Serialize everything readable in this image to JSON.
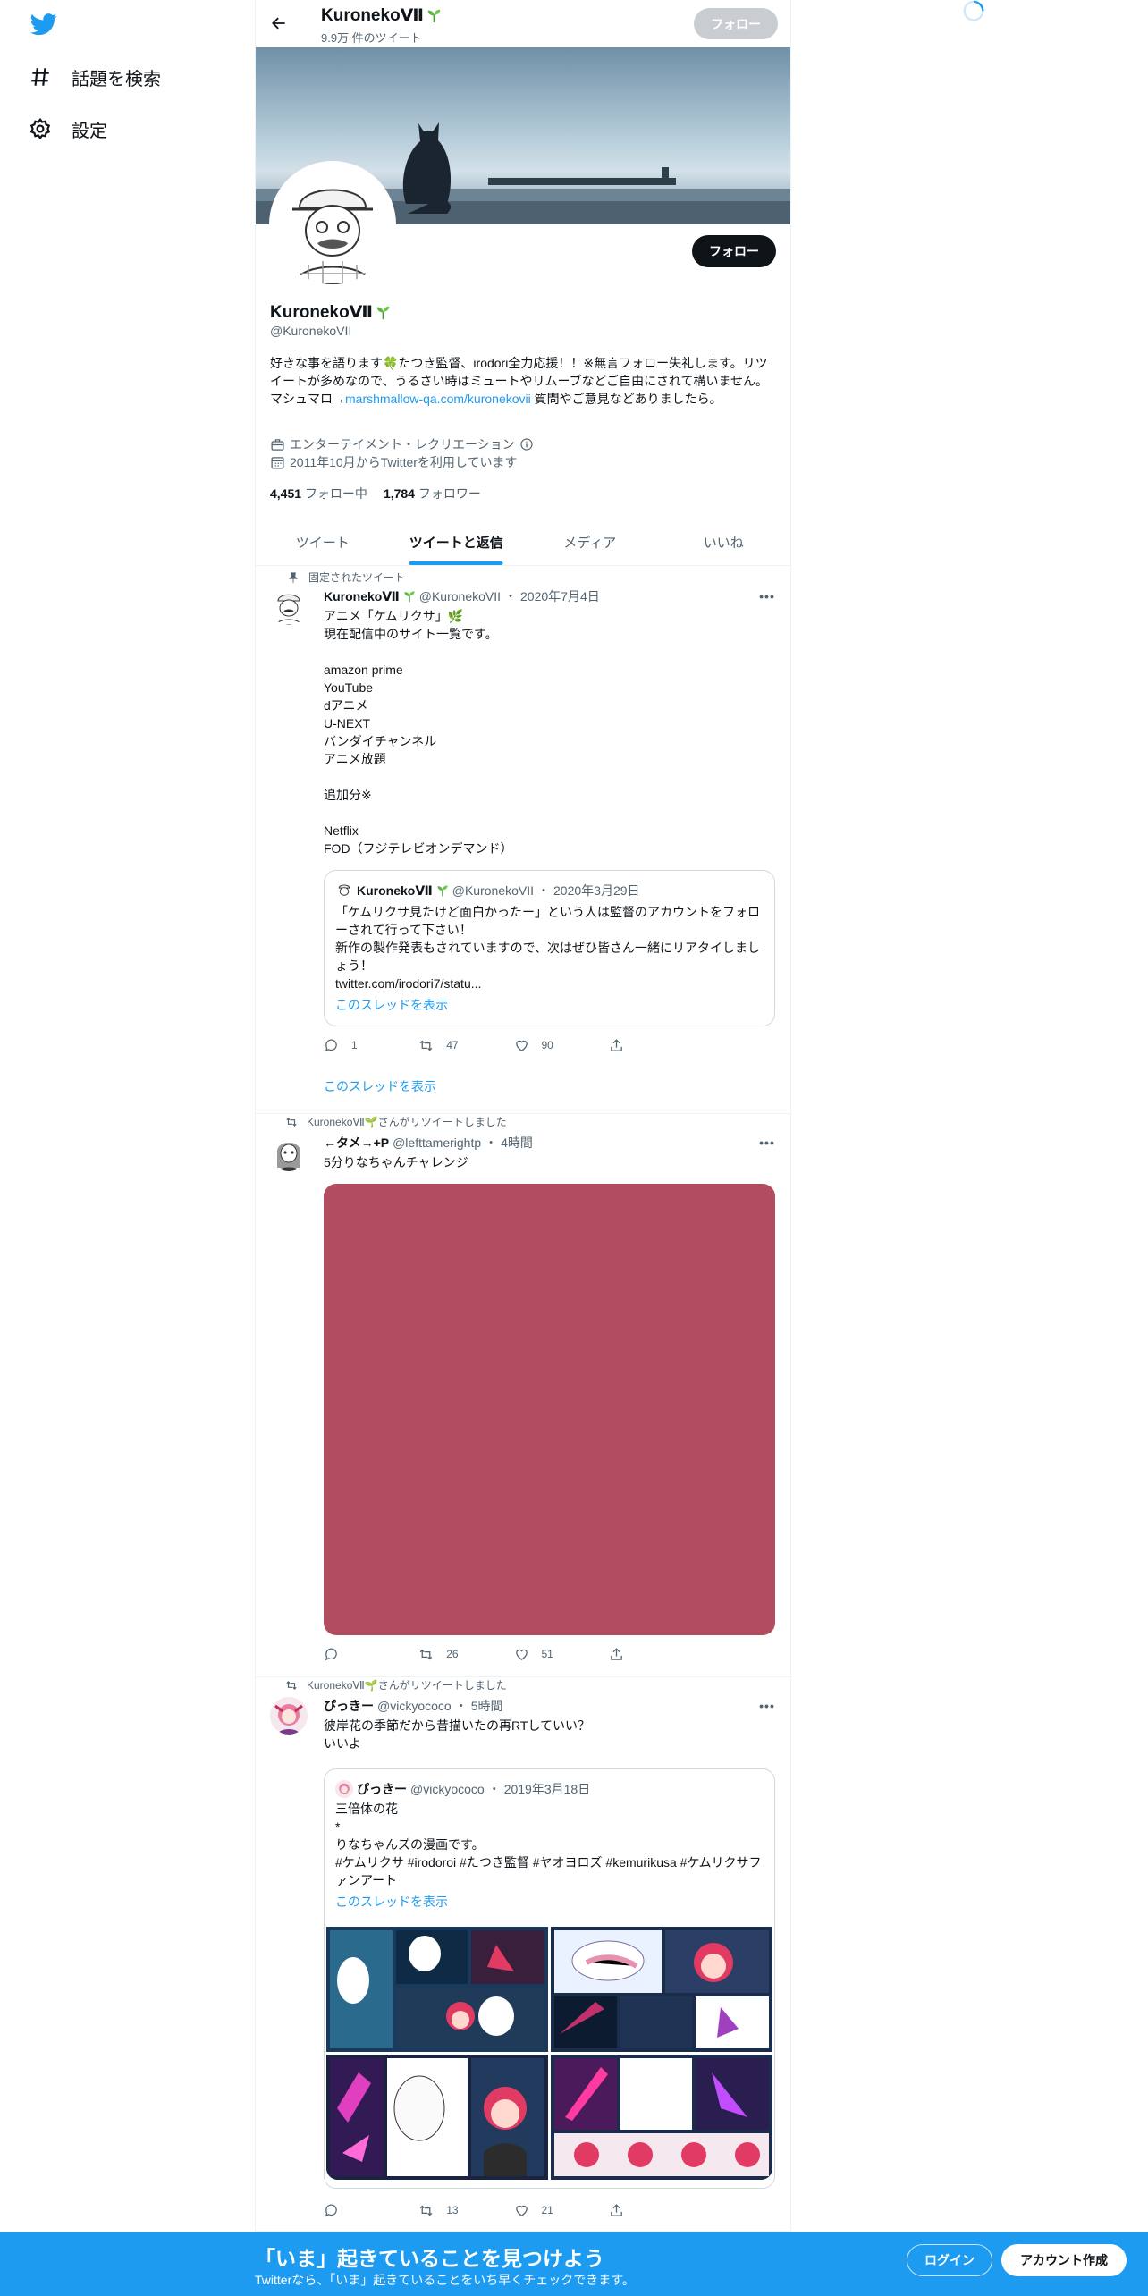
{
  "nav": {
    "explore_label": "話題を検索",
    "settings_label": "設定"
  },
  "header": {
    "name": "KuronekoⅦ",
    "tweet_count": "9.9万 件のツイート",
    "follow_label": "フォロー"
  },
  "profile": {
    "follow_label": "フォロー",
    "name": "KuronekoⅦ",
    "handle": "@KuronekoVII",
    "bio_part1": "好きな事を語ります🍀たつき監督、irodori全力応援！！※無言フォロー失礼します。リツイートが多めなので、うるさい時はミュートやリムーブなどご自由にされて構いません。マシュマロ→",
    "bio_link": "marshmallow-qa.com/kuronekovii",
    "bio_part2": " 質問やご意見などありましたら。",
    "category": "エンターテイメント・レクリエーション",
    "joined": "2011年10月からTwitterを利用しています",
    "following_count": "4,451",
    "following_label": "フォロー中",
    "followers_count": "1,784",
    "followers_label": "フォロワー"
  },
  "tabs": [
    {
      "label": "ツイート"
    },
    {
      "label": "ツイートと返信"
    },
    {
      "label": "メディア"
    },
    {
      "label": "いいね"
    }
  ],
  "tweets": [
    {
      "social": "固定されたツイート",
      "name": "KuronekoⅦ",
      "handle": "@KuronekoVII",
      "sep": "・",
      "time": "2020年7月4日",
      "text": "アニメ「ケムリクサ」🌿\n現在配信中のサイト一覧です。\n\namazon prime\nYouTube\ndアニメ\nU-NEXT\nバンダイチャンネル\nアニメ放題\n\n追加分※\n\nNetflix\nFOD（フジテレビオンデマンド）",
      "quote": {
        "name": "KuronekoⅦ",
        "handle": "@KuronekoVII",
        "sep": "・",
        "time": "2020年3月29日",
        "text": "「ケムリクサ見たけど面白かったー」という人は監督のアカウントをフォローされて行って下さい！\n新作の製作発表もされていますので、次はぜひ皆さん一緒にリアタイしましょう！\ntwitter.com/irodori7/statu...",
        "thread_link": "このスレッドを表示"
      },
      "replies": "1",
      "retweets": "47",
      "likes": "90",
      "thread_link": "このスレッドを表示"
    },
    {
      "social": "KuronekoⅦ🌱さんがリツイートしました",
      "name": "←タメ→+P",
      "handle": "@lefttamerightp",
      "sep": "・",
      "time": "4時間",
      "text": "5分りなちゃんチャレンジ",
      "media_color": "#b24c5f",
      "replies": "",
      "retweets": "26",
      "likes": "51"
    },
    {
      "social": "KuronekoⅦ🌱さんがリツイートしました",
      "name": "ぴっきー",
      "handle": "@vickyococo",
      "sep": "・",
      "time": "5時間",
      "text": "彼岸花の季節だから昔描いたの再RTしていい？\nいいよ",
      "quote": {
        "name": "ぴっきー",
        "handle": "@vickyococo",
        "sep": "・",
        "time": "2019年3月18日",
        "text": "三倍体の花\n*\nりなちゃんズの漫画です。\n#ケムリクサ #irodoroi #たつき監督 #ヤオヨロズ #kemurikusa #ケムリクサファンアート",
        "thread_link": "このスレッドを表示"
      },
      "replies": "",
      "retweets": "13",
      "likes": "21"
    }
  ],
  "bottom_bar": {
    "title": "「いま」起きていることを見つけよう",
    "subtitle": "Twitterなら、「いま」起きていることをいち早くチェックできます。",
    "login_label": "ログイン",
    "signup_label": "アカウント作成"
  }
}
